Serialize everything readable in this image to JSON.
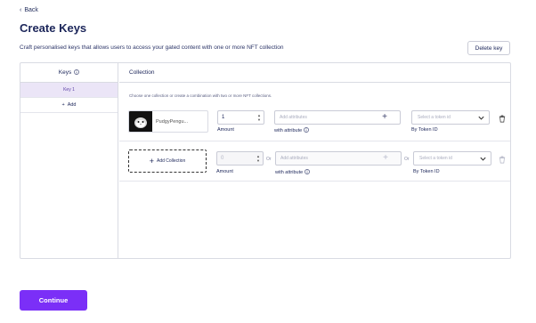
{
  "nav": {
    "back_label": "Back"
  },
  "header": {
    "title": "Create Keys",
    "subtitle": "Craft personalised keys that allows users to access your gated content with one or more NFT collection",
    "delete_label": "Delete key"
  },
  "keys": {
    "heading": "Keys",
    "items": [
      {
        "label": "Key 1",
        "active": true
      }
    ],
    "add_label": "Add"
  },
  "collection": {
    "heading": "Collection",
    "hint": "Choose one collection or create a combination with two or more NFT collections.",
    "rows": [
      {
        "nft_name": "PudgyPengu...",
        "amount": "1",
        "amount_label": "Amount",
        "attr_placeholder": "Add attributes",
        "attr_label": "with attribute",
        "token_placeholder": "Select a token id",
        "token_label": "By Token ID"
      },
      {
        "add_collection_label": "Add Collection",
        "amount": "0",
        "amount_label": "Amount",
        "or_1": "Or",
        "attr_placeholder": "Add attributes",
        "attr_label": "with attribute",
        "or_2": "Or",
        "token_placeholder": "Select a token id",
        "token_label": "By Token ID"
      }
    ]
  },
  "footer": {
    "continue_label": "Continue"
  },
  "colors": {
    "accent": "#7b2ff7",
    "title": "#1b2559",
    "active_key_bg": "#ebe5f7"
  }
}
